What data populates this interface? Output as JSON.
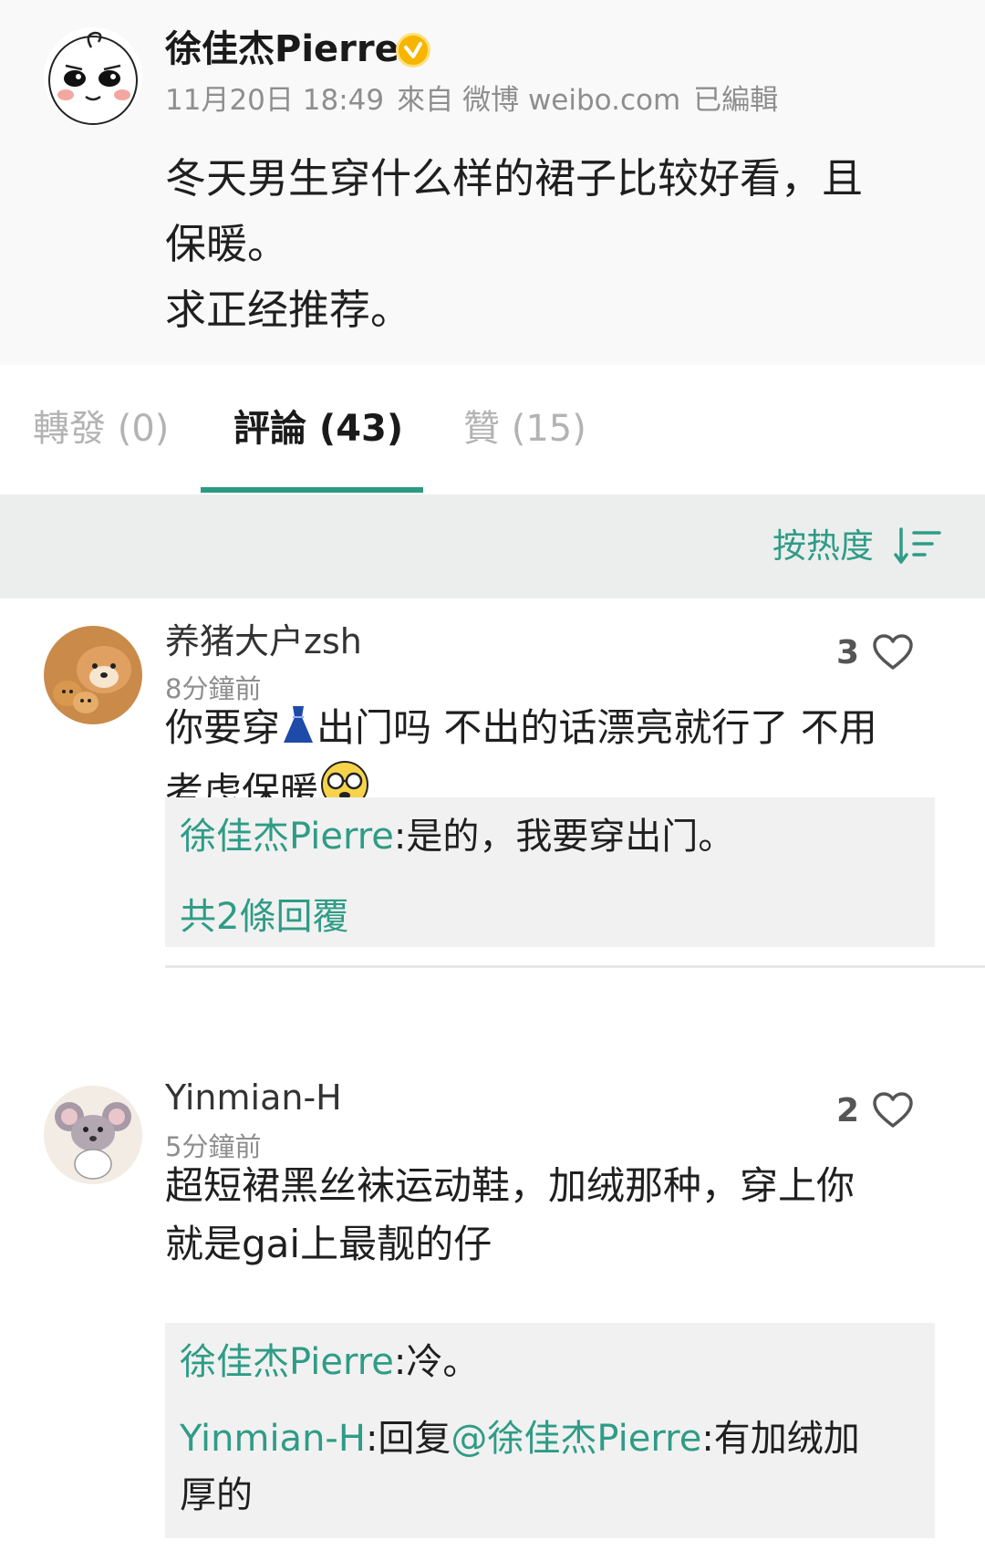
{
  "post": {
    "author": "徐佳杰Pierre",
    "date": "11月20日 18:49",
    "source_prefix": "來自",
    "source": "微博 weibo.com",
    "edited": "已編輯",
    "body_lines": [
      "冬天男生穿什么样的裙子比较好看，且",
      "保暖。",
      "求正经推荐。"
    ]
  },
  "tabs": [
    {
      "label": "轉發 (0)",
      "active": false
    },
    {
      "label": "評論 (43)",
      "active": true
    },
    {
      "label": "贊 (15)",
      "active": false
    }
  ],
  "sort": {
    "label": "按热度",
    "icon": "sort-icon"
  },
  "comments": [
    {
      "user": "养猪大户zsh",
      "time": "8分鐘前",
      "likes": "3",
      "body_line1_a": "你要穿",
      "body_line1_b": "出门吗 不出的话漂亮就行了 不用",
      "body_line2": "考虑保暖",
      "replies": [
        {
          "who": "徐佳杰Pierre",
          "text": ":是的，我要穿出门。"
        }
      ],
      "more_replies": "共2條回覆"
    },
    {
      "user": "Yinmian-H",
      "time": "5分鐘前",
      "likes": "2",
      "body_lines": [
        "超短裙黑丝袜运动鞋，加绒那种，穿上你",
        "就是gai上最靓的仔"
      ],
      "replies": [
        {
          "who": "徐佳杰Pierre",
          "text": ":冷。"
        },
        {
          "who": "Yinmian-H",
          "mid": ":回复",
          "mention": "@徐佳杰Pierre",
          "text": ":有加绒加",
          "text2": "厚的"
        }
      ]
    }
  ],
  "colors": {
    "accent": "#2e9c86",
    "verified": "#f7b500",
    "sortbar_bg": "#eceeee"
  }
}
